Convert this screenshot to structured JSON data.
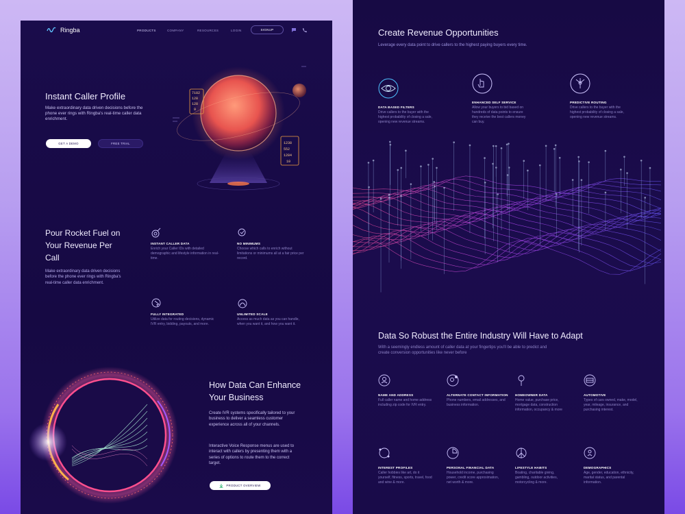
{
  "nav": {
    "brand": "Ringba",
    "links": [
      "PRODUCTS",
      "COMPANY",
      "RESOURCES",
      "LOGIN"
    ],
    "signup": "SIGNUP"
  },
  "hero": {
    "title": "Instant Caller Profile",
    "description": "Make extraordinary data driven decisions before the phone ever rings with Ringba's real-time caller data enrichment.",
    "demo_button": "GET A DEMO",
    "trial_button": "FREE TRIAL",
    "hud_left": [
      "7182",
      "128",
      "128",
      "9"
    ],
    "hud_right": [
      "1238",
      "552",
      "1284",
      "10"
    ]
  },
  "rocket": {
    "title": "Pour Rocket Fuel on Your Revenue Per Call",
    "description": "Make extraordinary data driven decisions before the phone ever rings with Ringba's real-time caller data enrichment.",
    "features": [
      {
        "title": "INSTANT CALLER DATA",
        "desc": "Enrich your Caller IDs with detailed demographic and lifestyle information in real-time."
      },
      {
        "title": "NO MINIMUMS",
        "desc": "Choose which calls to enrich without limitations or minimums all at a fair price per record."
      },
      {
        "title": "FULLY INTEGRATED",
        "desc": "Utilize data for routing decisions, dynamic IVR entry, bidding, payouts, and more."
      },
      {
        "title": "UNLIMITED SCALE",
        "desc": "Access as much data as you can handle, when you want it, and how you want it."
      }
    ]
  },
  "enhance": {
    "title": "How Data Can Enhance Your Business",
    "para1": "Create IVR systems specifically tailored to your business to deliver a seamless customer experience across all of your channels.",
    "para2": "Interactive Voice Response menus are used to interact with callers by presenting them with a series of options to route them to the correct target.",
    "button": "PRODUCT OVERVIEW"
  },
  "revenue": {
    "title": "Create Revenue Opportunities",
    "description": "Leverage every data point to drive callers to the highest paying buyers every time.",
    "features": [
      {
        "title": "DATA BASED FILTERS",
        "desc": "Drive callers to the buyer with the highest probability of closing a sale, opening new revenue streams."
      },
      {
        "title": "ENHANCED SELF SERVICE",
        "desc": "Allow your buyers to bid based on hundreds of data points to ensure they receive the best callers money can buy."
      },
      {
        "title": "PREDICTIVE ROUTING",
        "desc": "Drive callers to the buyer with the highest probability of closing a sale, opening new revenue streams."
      }
    ]
  },
  "robust": {
    "title": "Data So Robust the Entire Industry Will Have to Adapt",
    "description": "With a seemingly endless amount of caller data at your fingertips you'll be able to predict and create conversion opportunities like never before",
    "items": [
      {
        "title": "NAME AND ADDRESS",
        "desc": "Full caller name and home address including zip code for IVR entry."
      },
      {
        "title": "ALTERNATE CONTACT INFORMATION",
        "desc": "Phone numbers, email addresses, and business information."
      },
      {
        "title": "HOMEOWNER DATA",
        "desc": "Home value, purchase price, mortgage data, construction information, occupancy & more"
      },
      {
        "title": "AUTOMOTIVE",
        "desc": "Types of cars owned, make, model, year, mileage, insurance, and purchasing interest."
      },
      {
        "title": "INTEREST PROFILES",
        "desc": "Caller hobbies like art, do it yourself, fitness, sports, travel, food and wine & more."
      },
      {
        "title": "PERSONAL FINANCIAL DATA",
        "desc": "Household income, purchasing power, credit score approximation, net worth & more."
      },
      {
        "title": "LIFESTYLE HABITS",
        "desc": "Boating, charitable giving, gambling, outdoor activities, motorcycling & more."
      },
      {
        "title": "DEMOGRAPHICS",
        "desc": "Age, gender, education, ethnicity, marital status, and parental information."
      }
    ]
  }
}
